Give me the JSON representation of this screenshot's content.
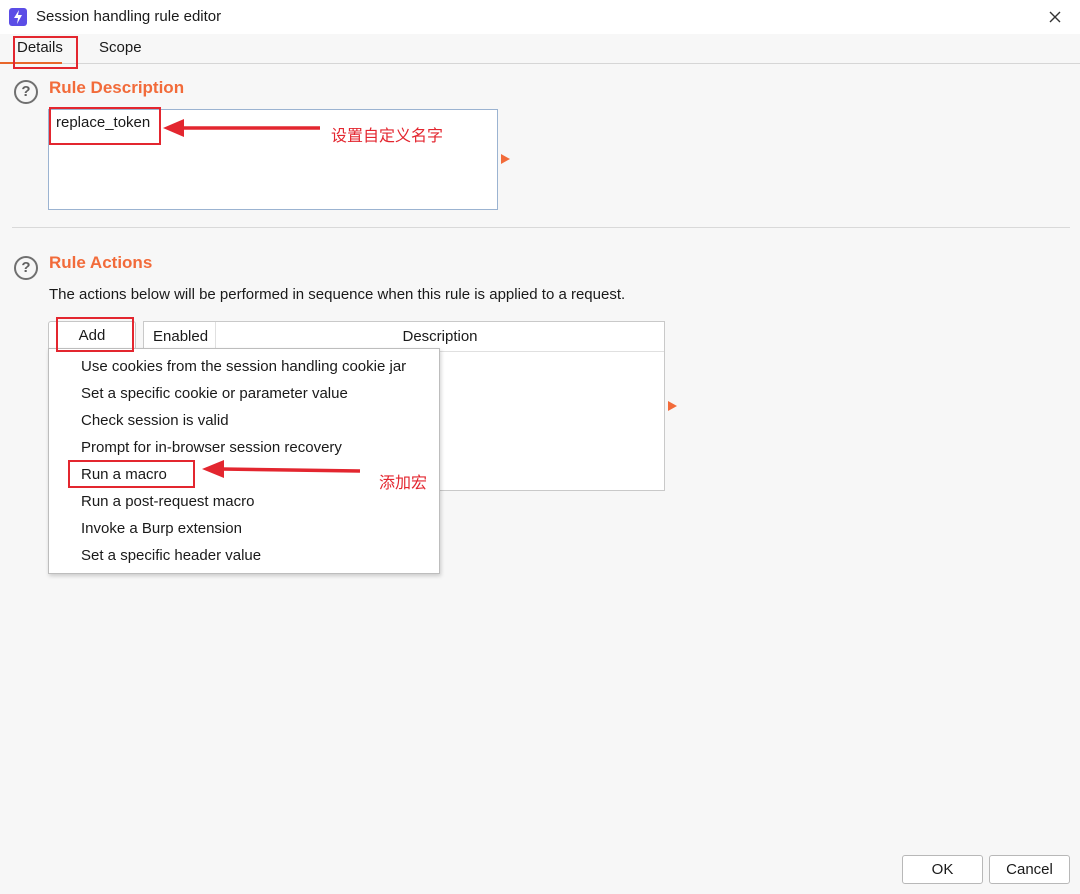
{
  "window": {
    "title": "Session handling rule editor"
  },
  "tabs": [
    {
      "label": "Details"
    },
    {
      "label": "Scope"
    }
  ],
  "rule_description": {
    "heading": "Rule Description",
    "value": "replace_token"
  },
  "rule_actions": {
    "heading": "Rule Actions",
    "description": "The actions below will be performed in sequence when this rule is applied to a request.",
    "add_label": "Add",
    "columns": {
      "enabled": "Enabled",
      "description": "Description"
    },
    "add_menu": [
      "Use cookies from the session handling cookie jar",
      "Set a specific cookie or parameter value",
      "Check session is valid",
      "Prompt for in-browser session recovery",
      "Run a macro",
      "Run a post-request macro",
      "Invoke a Burp extension",
      "Set a specific header value"
    ]
  },
  "annotations": {
    "name_note": "设置自定义名字",
    "macro_note": "添加宏"
  },
  "footer": {
    "ok": "OK",
    "cancel": "Cancel"
  },
  "colors": {
    "accent": "#f26b3a",
    "annotation": "#e3262f",
    "app_icon": "#5b4de6"
  }
}
